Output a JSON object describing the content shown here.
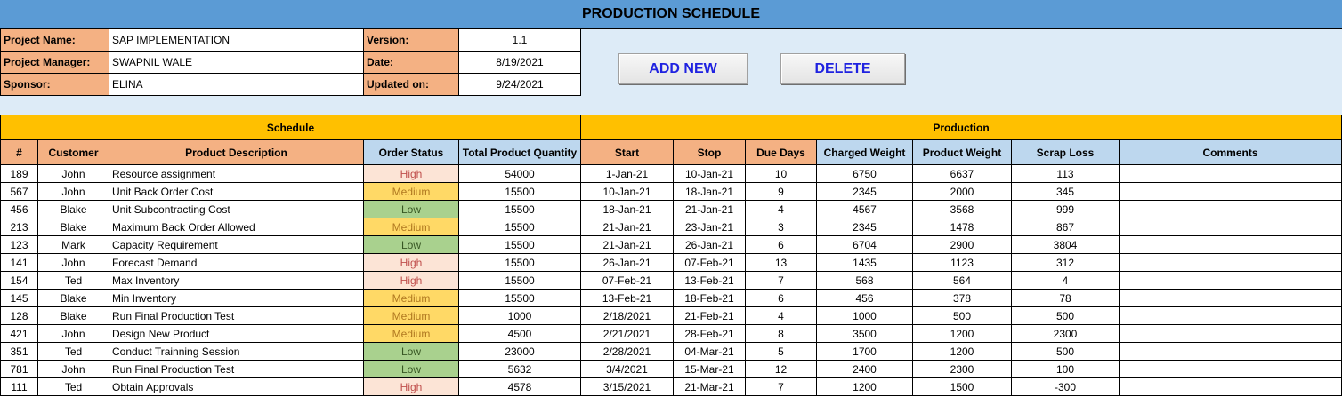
{
  "title": "PRODUCTION SCHEDULE",
  "info": {
    "project_name_label": "Project Name:",
    "project_name": "SAP IMPLEMENTATION",
    "manager_label": "Project Manager:",
    "manager": "SWAPNIL WALE",
    "sponsor_label": "Sponsor:",
    "sponsor": "ELINA",
    "version_label": "Version:",
    "version": "1.1",
    "date_label": "Date:",
    "date": "8/19/2021",
    "updated_label": "Updated on:",
    "updated": "9/24/2021"
  },
  "buttons": {
    "add_new": "ADD NEW",
    "delete": "DELETE"
  },
  "groups": {
    "schedule": "Schedule",
    "production": "Production"
  },
  "columns": [
    "#",
    "Customer",
    "Product Description",
    "Order Status",
    "Total Product Quantity",
    "Start",
    "Stop",
    "Due Days",
    "Charged Weight",
    "Product Weight",
    "Scrap Loss",
    "Comments"
  ],
  "rows": [
    {
      "id": "189",
      "customer": "John",
      "desc": "Resource assignment",
      "status": "High",
      "qty": "54000",
      "start": "1-Jan-21",
      "stop": "10-Jan-21",
      "due": "10",
      "charged": "6750",
      "product": "6637",
      "scrap": "113",
      "comments": ""
    },
    {
      "id": "567",
      "customer": "John",
      "desc": "Unit Back Order Cost",
      "status": "Medium",
      "qty": "15500",
      "start": "10-Jan-21",
      "stop": "18-Jan-21",
      "due": "9",
      "charged": "2345",
      "product": "2000",
      "scrap": "345",
      "comments": ""
    },
    {
      "id": "456",
      "customer": "Blake",
      "desc": "Unit Subcontracting Cost",
      "status": "Low",
      "qty": "15500",
      "start": "18-Jan-21",
      "stop": "21-Jan-21",
      "due": "4",
      "charged": "4567",
      "product": "3568",
      "scrap": "999",
      "comments": ""
    },
    {
      "id": "213",
      "customer": "Blake",
      "desc": "Maximum Back Order Allowed",
      "status": "Medium",
      "qty": "15500",
      "start": "21-Jan-21",
      "stop": "23-Jan-21",
      "due": "3",
      "charged": "2345",
      "product": "1478",
      "scrap": "867",
      "comments": ""
    },
    {
      "id": "123",
      "customer": "Mark",
      "desc": "Capacity Requirement",
      "status": "Low",
      "qty": "15500",
      "start": "21-Jan-21",
      "stop": "26-Jan-21",
      "due": "6",
      "charged": "6704",
      "product": "2900",
      "scrap": "3804",
      "comments": ""
    },
    {
      "id": "141",
      "customer": "John",
      "desc": "Forecast Demand",
      "status": "High",
      "qty": "15500",
      "start": "26-Jan-21",
      "stop": "07-Feb-21",
      "due": "13",
      "charged": "1435",
      "product": "1123",
      "scrap": "312",
      "comments": ""
    },
    {
      "id": "154",
      "customer": "Ted",
      "desc": "Max Inventory",
      "status": "High",
      "qty": "15500",
      "start": "07-Feb-21",
      "stop": "13-Feb-21",
      "due": "7",
      "charged": "568",
      "product": "564",
      "scrap": "4",
      "comments": ""
    },
    {
      "id": "145",
      "customer": "Blake",
      "desc": "Min Inventory",
      "status": "Medium",
      "qty": "15500",
      "start": "13-Feb-21",
      "stop": "18-Feb-21",
      "due": "6",
      "charged": "456",
      "product": "378",
      "scrap": "78",
      "comments": ""
    },
    {
      "id": "128",
      "customer": "Blake",
      "desc": "Run Final Production Test",
      "status": "Medium",
      "qty": "1000",
      "start": "2/18/2021",
      "stop": "21-Feb-21",
      "due": "4",
      "charged": "1000",
      "product": "500",
      "scrap": "500",
      "comments": ""
    },
    {
      "id": "421",
      "customer": "John",
      "desc": "Design New Product",
      "status": "Medium",
      "qty": "4500",
      "start": "2/21/2021",
      "stop": "28-Feb-21",
      "due": "8",
      "charged": "3500",
      "product": "1200",
      "scrap": "2300",
      "comments": ""
    },
    {
      "id": "351",
      "customer": "Ted",
      "desc": "Conduct Trainning Session",
      "status": "Low",
      "qty": "23000",
      "start": "2/28/2021",
      "stop": "04-Mar-21",
      "due": "5",
      "charged": "1700",
      "product": "1200",
      "scrap": "500",
      "comments": ""
    },
    {
      "id": "781",
      "customer": "John",
      "desc": "Run Final Production Test",
      "status": "Low",
      "qty": "5632",
      "start": "3/4/2021",
      "stop": "15-Mar-21",
      "due": "12",
      "charged": "2400",
      "product": "2300",
      "scrap": "100",
      "comments": ""
    },
    {
      "id": "111",
      "customer": "Ted",
      "desc": "Obtain Approvals",
      "status": "High",
      "qty": "4578",
      "start": "3/15/2021",
      "stop": "21-Mar-21",
      "due": "7",
      "charged": "1200",
      "product": "1500",
      "scrap": "-300",
      "comments": ""
    }
  ],
  "colors": {
    "title_bar": "#5b9bd5",
    "header_panel": "#ddebf7",
    "group_header": "#ffc000",
    "label_cell": "#f4b183",
    "production_header": "#bdd7ee",
    "high": "#fce4d6",
    "medium": "#ffd966",
    "low": "#a9d18e",
    "button_text": "#1f22e0"
  }
}
